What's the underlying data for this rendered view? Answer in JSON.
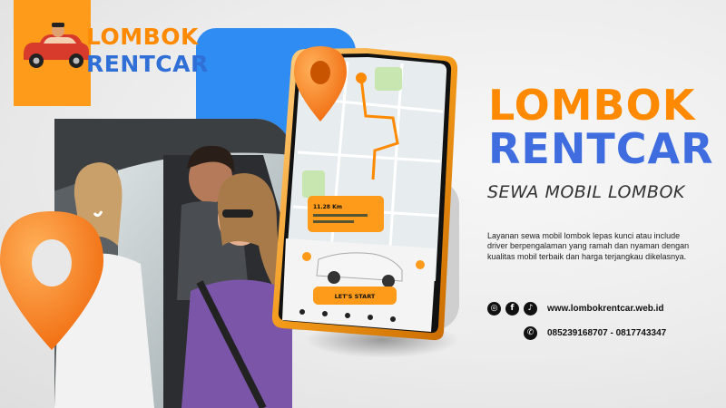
{
  "brand": {
    "logo_line1": "LOMBOK",
    "logo_line2": "RENTCAR"
  },
  "headline": {
    "line1": "LOMBOK",
    "line2": "RENTCAR",
    "subtitle": "SEWA MOBIL LOMBOK"
  },
  "description": "Layanan sewa mobil lombok lepas kunci atau include driver berpengalaman yang ramah dan nyaman dengan kualitas mobil terbaik dan harga terjangkau dikelasnya.",
  "contact": {
    "website": "www.lombokrentcar.web.id",
    "phones": "085239168707 - 0817743347"
  },
  "social_icons": [
    "instagram-icon",
    "facebook-icon",
    "tiktok-icon",
    "whatsapp-icon"
  ],
  "phone_screen": {
    "card_line1": "11.28 Km",
    "button_label": "LET'S START"
  },
  "colors": {
    "orange": "#ff8a00",
    "blue": "#3f6de0",
    "accent_blue": "#2f8cf2"
  }
}
